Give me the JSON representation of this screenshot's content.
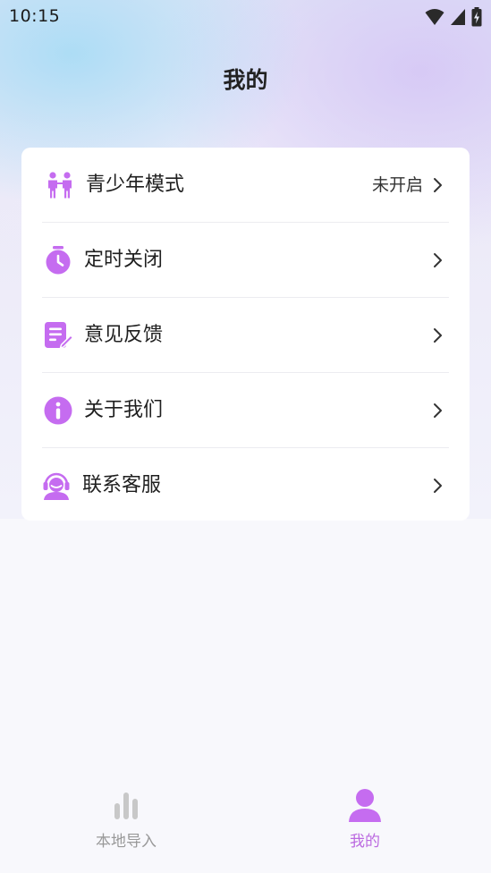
{
  "status_bar": {
    "time": "10:15",
    "icons": [
      "wifi-icon",
      "cellular-signal-icon",
      "battery-charging-icon"
    ]
  },
  "header": {
    "title": "我的"
  },
  "menu": {
    "items": [
      {
        "label": "青少年模式",
        "value": "未开启",
        "icon": "teen-mode-icon"
      },
      {
        "label": "定时关闭",
        "value": "",
        "icon": "timer-icon"
      },
      {
        "label": "意见反馈",
        "value": "",
        "icon": "feedback-icon"
      },
      {
        "label": "关于我们",
        "value": "",
        "icon": "info-icon"
      },
      {
        "label": "联系客服",
        "value": "",
        "icon": "customer-service-icon"
      }
    ]
  },
  "tab_bar": {
    "tabs": [
      {
        "label": "本地导入",
        "icon": "bar-chart-icon",
        "active": false
      },
      {
        "label": "我的",
        "icon": "user-icon",
        "active": true
      }
    ]
  },
  "colors": {
    "accent": "#bb6ae0",
    "icon_purple": "#c56cf0",
    "inactive": "#999999"
  }
}
